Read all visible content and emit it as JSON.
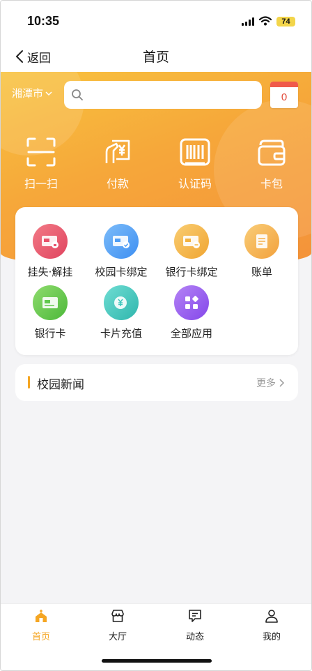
{
  "status_bar": {
    "time": "10:35",
    "battery": "74"
  },
  "nav": {
    "back_label": "返回",
    "title": "首页"
  },
  "header": {
    "city": "湘潭市",
    "search_placeholder": "",
    "calendar_count": "0"
  },
  "quick_actions": [
    {
      "label": "扫一扫",
      "icon": "scan-icon"
    },
    {
      "label": "付款",
      "icon": "payment-icon"
    },
    {
      "label": "认证码",
      "icon": "barcode-icon"
    },
    {
      "label": "卡包",
      "icon": "wallet-icon"
    }
  ],
  "services": [
    {
      "label": "挂失·解挂",
      "icon": "report-loss-icon",
      "color": "#e8506a"
    },
    {
      "label": "校园卡绑定",
      "icon": "campus-card-icon",
      "color": "#4f9ef5"
    },
    {
      "label": "银行卡绑定",
      "icon": "bank-card-bind-icon",
      "color": "#f3b23f"
    },
    {
      "label": "账单",
      "icon": "bill-icon",
      "color": "#f5b04a"
    },
    {
      "label": "银行卡",
      "icon": "bank-card-icon",
      "color": "#62c84e"
    },
    {
      "label": "卡片充值",
      "icon": "recharge-icon",
      "color": "#3fc7bd"
    },
    {
      "label": "全部应用",
      "icon": "all-apps-icon",
      "color": "#9b5cf0"
    }
  ],
  "news": {
    "title": "校园新闻",
    "more_label": "更多"
  },
  "tabbar": {
    "active_color": "#f5a623",
    "items": [
      {
        "label": "首页",
        "icon": "home-icon"
      },
      {
        "label": "大厅",
        "icon": "hall-icon"
      },
      {
        "label": "动态",
        "icon": "message-icon"
      },
      {
        "label": "我的",
        "icon": "profile-icon"
      }
    ]
  }
}
